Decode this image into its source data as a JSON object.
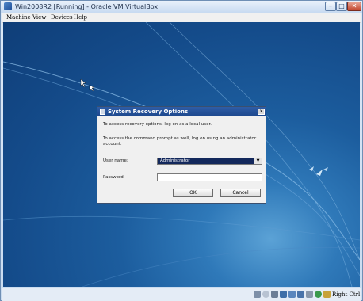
{
  "window": {
    "title": "Win2008R2 [Running] - Oracle VM VirtualBox",
    "minimize": "–",
    "maximize": "□",
    "close": "✕"
  },
  "menu": {
    "items": [
      "Machine",
      "View",
      "Devices",
      "Help"
    ]
  },
  "dialog": {
    "title": "System Recovery Options",
    "close": "x",
    "line1": "To access recovery options, log on as a local user.",
    "line2a": "To access the command prompt as well, log on using an administrator",
    "line2b": "account.",
    "username_label": "User name:",
    "username_value": "Administrator",
    "password_label": "Password:",
    "password_value": "",
    "ok": "OK",
    "cancel": "Cancel"
  },
  "statusbar": {
    "host_key": "Right Ctrl",
    "icons": [
      "hard-disk-icon",
      "optical-drive-icon",
      "audio-icon",
      "usb-icon",
      "shared-folders-icon",
      "display-icon",
      "network-icon",
      "recording-icon",
      "mouse-integration-icon",
      "virtualization-icon"
    ]
  },
  "colors": {
    "dialog_title": "#1d478d",
    "selected_user": "#13285c",
    "desktop": "#1c5d9e"
  }
}
